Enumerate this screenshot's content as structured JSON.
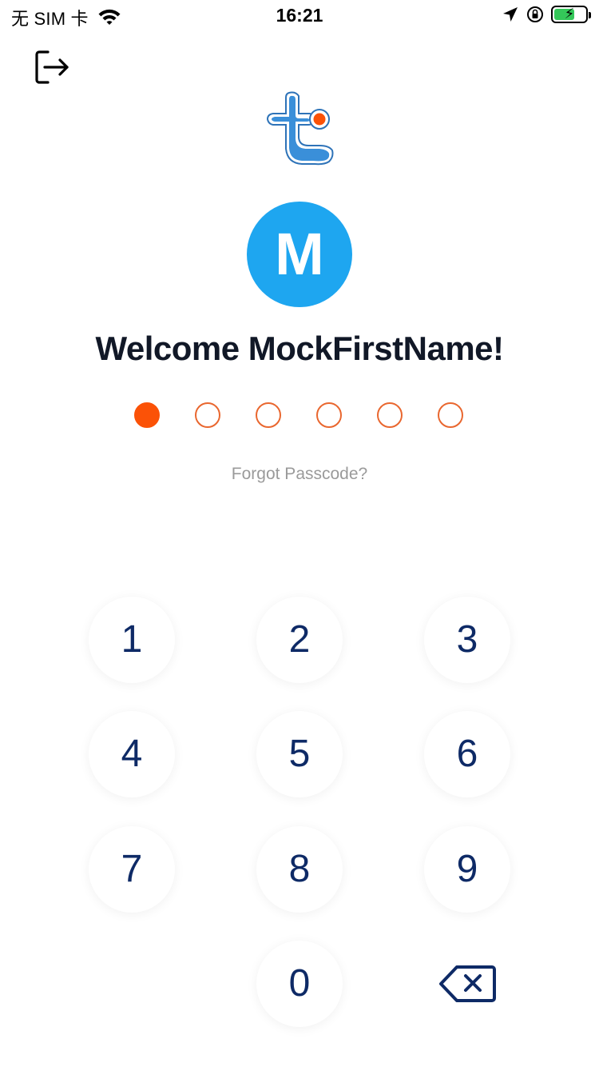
{
  "status_bar": {
    "carrier": "无 SIM 卡",
    "time": "16:21"
  },
  "header": {
    "exit_icon": "logout-icon",
    "logo": "app-logo"
  },
  "profile": {
    "avatar_letter": "M",
    "avatar_color": "#1ea6f0",
    "welcome_text": "Welcome MockFirstName!"
  },
  "passcode": {
    "length": 6,
    "filled": 1,
    "accent_color": "#fb5207"
  },
  "forgot_link": "Forgot Passcode?",
  "keypad": {
    "keys": [
      "1",
      "2",
      "3",
      "4",
      "5",
      "6",
      "7",
      "8",
      "9",
      "0"
    ],
    "backspace_icon": "backspace-icon",
    "text_color": "#0e2a66"
  }
}
